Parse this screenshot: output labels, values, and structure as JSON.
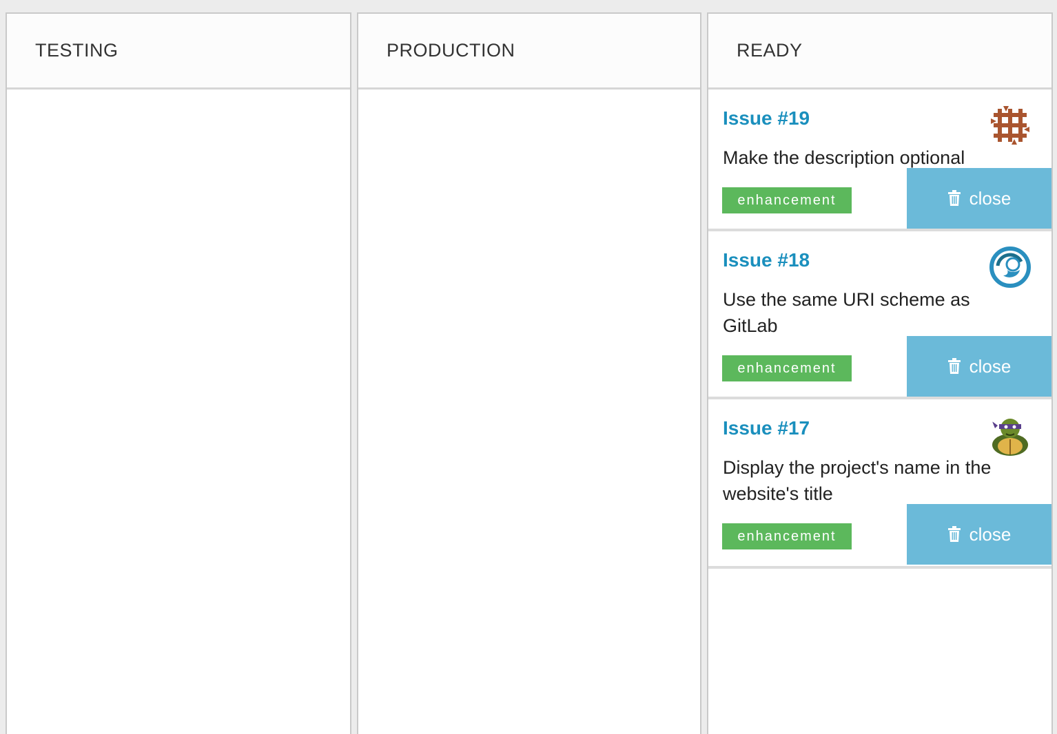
{
  "columns": [
    {
      "title": "TESTING",
      "cards": []
    },
    {
      "title": "PRODUCTION",
      "cards": []
    },
    {
      "title": "READY",
      "cards": [
        {
          "issue": "Issue #19",
          "description": "Make the description optional",
          "label": "enhancement",
          "close_label": "close",
          "avatar_icon": "brown-pattern-avatar"
        },
        {
          "issue": "Issue #18",
          "description": "Use the same URI scheme as GitLab",
          "label": "enhancement",
          "close_label": "close",
          "avatar_icon": "blue-swirl-avatar"
        },
        {
          "issue": "Issue #17",
          "description": "Display the project's name in the website's title",
          "label": "enhancement",
          "close_label": "close",
          "avatar_icon": "turtle-avatar"
        }
      ]
    }
  ],
  "colors": {
    "issue_link": "#1a8fbd",
    "label_bg": "#5cb85c",
    "close_bg": "#6bbad9"
  }
}
